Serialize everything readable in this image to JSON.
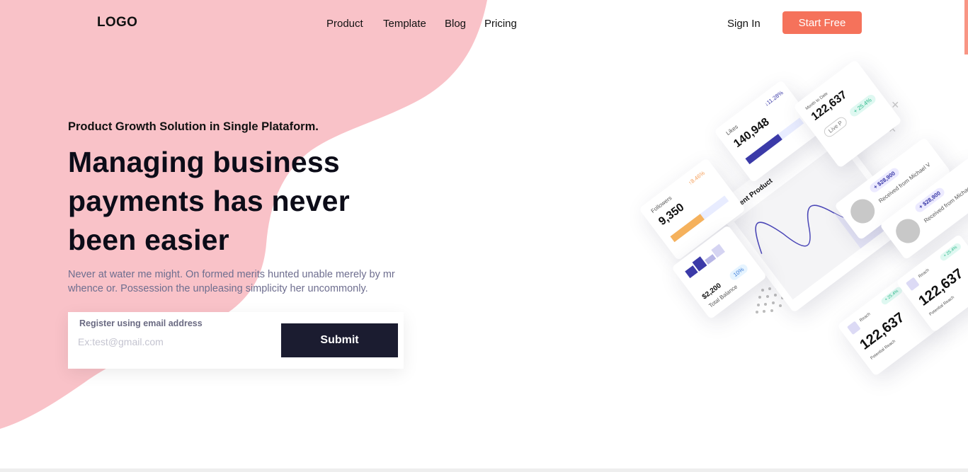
{
  "nav": {
    "logo": "LOGO",
    "links": [
      "Product",
      "Template",
      "Blog",
      "Pricing"
    ],
    "signin": "Sign In",
    "cta": "Start Free"
  },
  "hero": {
    "eyebrow": "Product Growth Solution in Single Plataform.",
    "headline_lines": [
      "Managing business",
      "payments has never",
      "been easier"
    ],
    "subtext": "Never at water me might. On formed merits hunted unable merely by mr whence or. Possession the unpleasing simplicity her uncommonly."
  },
  "form": {
    "label": "Register using email address",
    "placeholder": "Ex:test@gmail.com",
    "submit": "Submit"
  },
  "dashboard": {
    "likes": {
      "label": "Likes",
      "value": "140,948",
      "change": "11.28%",
      "fill": 0.6
    },
    "followers": {
      "label": "Followers",
      "value": "9,350",
      "change": "8.46%",
      "fill": 0.55
    },
    "total_card": {
      "label": "Month to Date",
      "value": "122,637",
      "badge": "+ 25.4%",
      "button": "Live P"
    },
    "recent_product": {
      "title": "Recent Product"
    },
    "payments": [
      {
        "amount": "+ $28,900",
        "label": "Received from Michael V"
      },
      {
        "amount": "+ $28,900",
        "label": "Received from Michael V"
      }
    ],
    "balance": {
      "label": "Total Balance",
      "value": "$2,200",
      "badge": "10%"
    },
    "reach": [
      {
        "label": "Reach",
        "value": "122,637",
        "sublabel": "Potential Reach",
        "badge": "+ 25.4%"
      },
      {
        "label": "Reach",
        "value": "122,637",
        "sublabel": "Potential Reach",
        "badge": "+ 25.4%"
      }
    ]
  },
  "colors": {
    "accent": "#f5725b",
    "blob": "#f9c2c8",
    "dark": "#1b1c30",
    "indigo": "#3b3aa8",
    "orange": "#f5b15c"
  }
}
